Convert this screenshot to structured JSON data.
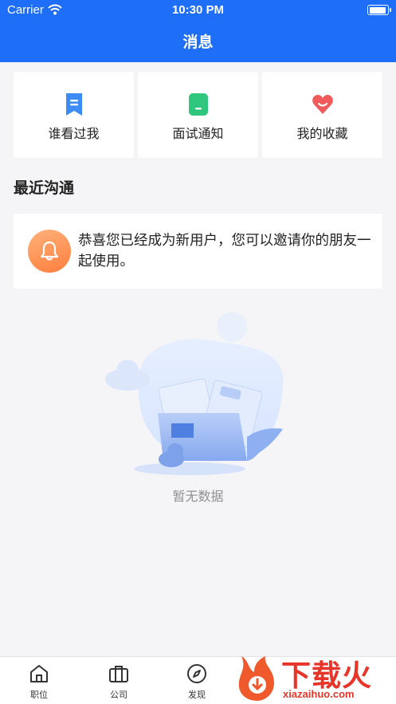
{
  "status_bar": {
    "carrier": "Carrier",
    "time": "10:30 PM"
  },
  "nav": {
    "title": "消息"
  },
  "quick_actions": [
    {
      "label": "谁看过我",
      "icon": "bookmark-icon",
      "color": "#3d8cf6"
    },
    {
      "label": "面试通知",
      "icon": "document-icon",
      "color": "#2ec77d"
    },
    {
      "label": "我的收藏",
      "icon": "heart-icon",
      "color": "#f05a5a"
    }
  ],
  "recent": {
    "title": "最近沟通",
    "message": {
      "icon": "bell-icon",
      "text": "恭喜您已经成为新用户，您可以邀请你的朋友一起使用。"
    }
  },
  "empty_state": {
    "text": "暂无数据"
  },
  "tabbar": [
    {
      "label": "职位",
      "icon": "home-icon"
    },
    {
      "label": "公司",
      "icon": "briefcase-icon"
    },
    {
      "label": "发现",
      "icon": "compass-icon"
    }
  ],
  "watermark": {
    "text": "下载火",
    "url": "xiazaihuo.com"
  },
  "colors": {
    "primary": "#1e6ef7",
    "background": "#f5f5f7",
    "accent_orange": "#ff7d3d",
    "watermark_red": "#e8352a"
  }
}
